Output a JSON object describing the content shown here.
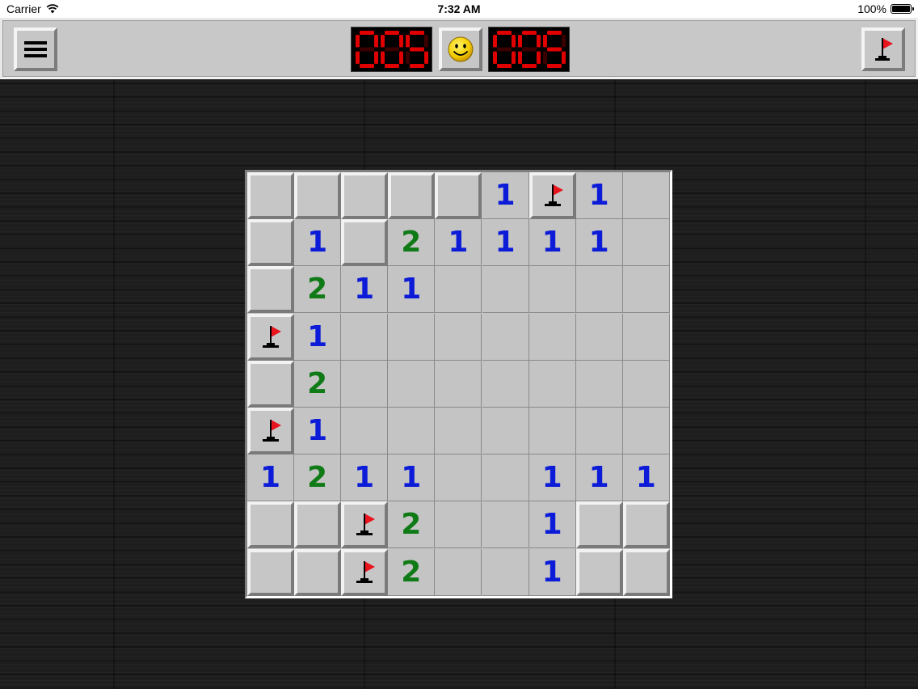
{
  "status_bar": {
    "carrier": "Carrier",
    "time": "7:32 AM",
    "battery": "100%"
  },
  "toolbar": {
    "menu_icon": "hamburger-menu-icon",
    "mines_counter": "005",
    "smiley_icon": "smiley-face-icon",
    "timer_counter": "005",
    "flag_mode_icon": "flag-icon"
  },
  "colors": {
    "number_1": "#0b1bd8",
    "number_2": "#0f7a16",
    "flag": "#e8141e",
    "led": "#e00000"
  },
  "board": {
    "rows": 9,
    "cols": 9,
    "cells": [
      [
        "C",
        "C",
        "C",
        "C",
        "C",
        "1",
        "F",
        "1",
        "O"
      ],
      [
        "C",
        "1",
        "C",
        "2",
        "1",
        "1",
        "1",
        "1",
        "O"
      ],
      [
        "C",
        "2",
        "1",
        "1",
        "O",
        "O",
        "O",
        "O",
        "O"
      ],
      [
        "F",
        "1",
        "O",
        "O",
        "O",
        "O",
        "O",
        "O",
        "O"
      ],
      [
        "C",
        "2",
        "O",
        "O",
        "O",
        "O",
        "O",
        "O",
        "O"
      ],
      [
        "F",
        "1",
        "O",
        "O",
        "O",
        "O",
        "O",
        "O",
        "O"
      ],
      [
        "1",
        "2",
        "1",
        "1",
        "O",
        "O",
        "1",
        "1",
        "1"
      ],
      [
        "C",
        "C",
        "F",
        "2",
        "O",
        "O",
        "1",
        "C",
        "C"
      ],
      [
        "C",
        "C",
        "F",
        "2",
        "O",
        "O",
        "1",
        "C",
        "C"
      ]
    ]
  }
}
